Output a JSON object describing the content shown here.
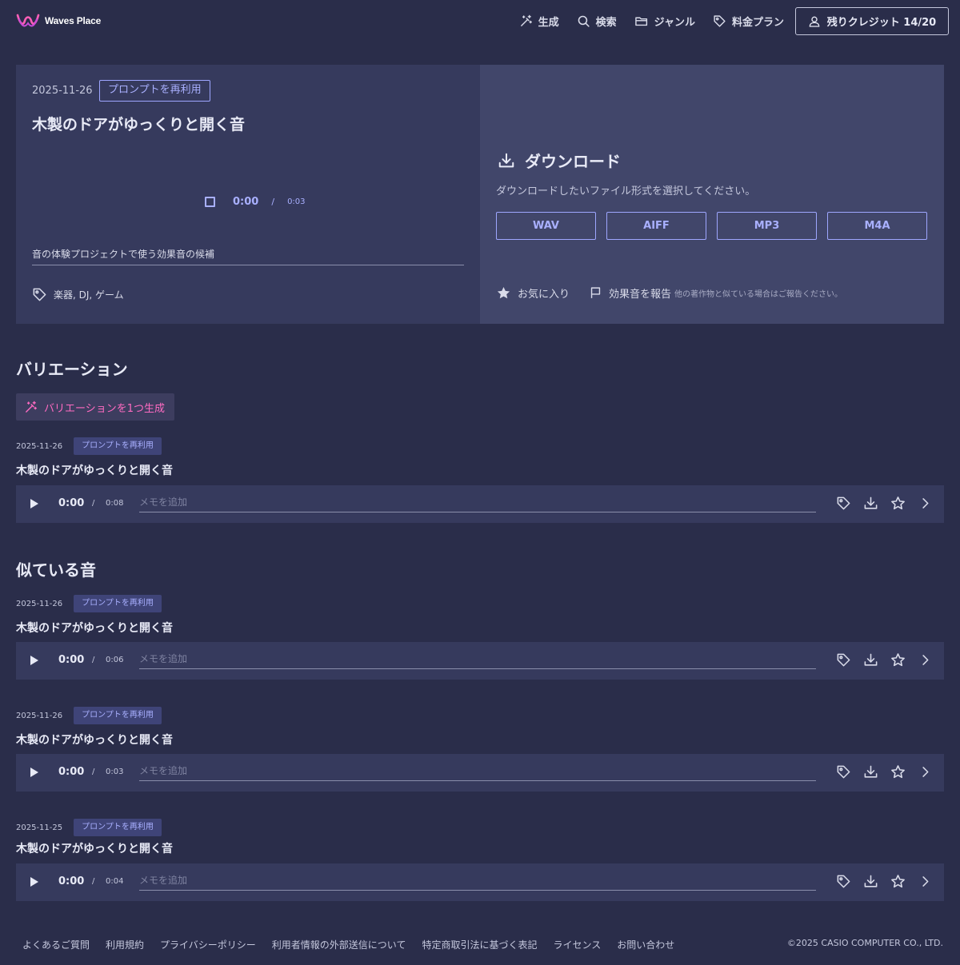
{
  "header": {
    "logo_text": "Waves Place",
    "nav": [
      {
        "label": "生成",
        "icon": "magic-wand-icon"
      },
      {
        "label": "検索",
        "icon": "search-icon"
      },
      {
        "label": "ジャンル",
        "icon": "folder-icon"
      },
      {
        "label": "料金プラン",
        "icon": "tag-icon"
      }
    ],
    "credits_label": "残りクレジット 14/20"
  },
  "sound": {
    "date": "2025-11-26",
    "reuse_label": "プロンプトを再利用",
    "title": "木製のドアがゆっくりと開く音",
    "current_time": "0:00",
    "time_sep": "/",
    "duration": "0:03",
    "memo": "音の体験プロジェクトで使う効果音の候補",
    "tags": "楽器, DJ, ゲーム"
  },
  "download": {
    "title": "ダウンロード",
    "description": "ダウンロードしたいファイル形式を選択してください。",
    "formats": [
      "WAV",
      "AIFF",
      "MP3",
      "M4A"
    ],
    "favorite_label": "お気に入り",
    "report_label": "効果音を報告",
    "report_note": "他の著作物と似ている場合はご報告ください。"
  },
  "variations": {
    "title": "バリエーション",
    "generate_label": "バリエーションを1つ生成",
    "items": [
      {
        "date": "2025-11-26",
        "reuse_label": "プロンプトを再利用",
        "title": "木製のドアがゆっくりと開く音",
        "current_time": "0:00",
        "time_sep": "/",
        "duration": "0:08",
        "memo_placeholder": "メモを追加"
      }
    ]
  },
  "similar": {
    "title": "似ている音",
    "items": [
      {
        "date": "2025-11-26",
        "reuse_label": "プロンプトを再利用",
        "title": "木製のドアがゆっくりと開く音",
        "current_time": "0:00",
        "time_sep": "/",
        "duration": "0:06",
        "memo_placeholder": "メモを追加"
      },
      {
        "date": "2025-11-26",
        "reuse_label": "プロンプトを再利用",
        "title": "木製のドアがゆっくりと開く音",
        "current_time": "0:00",
        "time_sep": "/",
        "duration": "0:03",
        "memo_placeholder": "メモを追加"
      },
      {
        "date": "2025-11-25",
        "reuse_label": "プロンプトを再利用",
        "title": "木製のドアがゆっくりと開く音",
        "current_time": "0:00",
        "time_sep": "/",
        "duration": "0:04",
        "memo_placeholder": "メモを追加"
      }
    ]
  },
  "footer": {
    "links": [
      "よくあるご質問",
      "利用規約",
      "プライバシーポリシー",
      "利用者情報の外部送信について",
      "特定商取引法に基づく表記",
      "ライセンス",
      "お問い合わせ"
    ],
    "copyright": "©2025 CASIO COMPUTER CO., LTD."
  },
  "colors": {
    "background": "#2a2d4a",
    "panel": "#363a5d",
    "panel_light": "#41466a",
    "accent": "#a9b0ff",
    "pink_accent": "#ff6bc2"
  }
}
